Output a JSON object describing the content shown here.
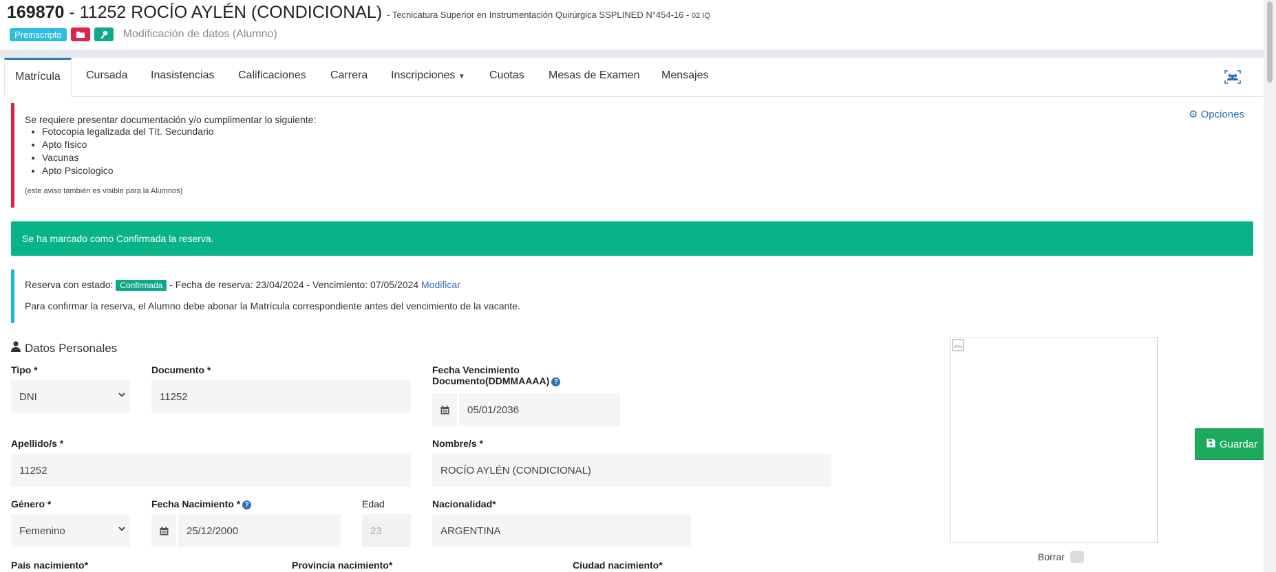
{
  "header": {
    "id": "169870",
    "separator": "-",
    "name": "11252 ROCÍO AYLÉN (CONDICIONAL)",
    "career": "- Tecnicatura Superior en Instrumentación Quirúrgica SSPLINED N°454-16 -",
    "group": "02 IQ",
    "status_badge": "Preinscripto",
    "modification_text": "Modificación de datos (Alumno)"
  },
  "tabs": [
    {
      "label": "Matrícula"
    },
    {
      "label": "Cursada"
    },
    {
      "label": "Inasistencias"
    },
    {
      "label": "Calificaciones"
    },
    {
      "label": "Carrera"
    },
    {
      "label": "Inscripciones"
    },
    {
      "label": "Cuotas"
    },
    {
      "label": "Mesas de Examen"
    },
    {
      "label": "Mensajes"
    }
  ],
  "options_link": "Opciones",
  "requirements": {
    "intro": "Se requiere presentar documentación y/o cumplimentar lo siguiente:",
    "items": [
      "Fotocopia legalizada del Tít. Secundario",
      "Apto físico",
      "Vacunas",
      "Apto Psicologico"
    ],
    "note": "(este aviso también es visible para la Alumnos)"
  },
  "success_message": "Se ha marcado como Confirmada la reserva.",
  "reservation": {
    "prefix": "Reserva con estado:",
    "status": "Confirmada",
    "details": "- Fecha de reserva: 23/04/2024 - Vencimiento: 07/05/2024",
    "modify_link": "Modificar",
    "info": "Para confirmar la reserva, el Alumno debe abonar la Matrícula correspondiente antes del vencimiento de la vacante."
  },
  "personal": {
    "section_title": "Datos Personales",
    "tipo_label": "Tipo *",
    "tipo_value": "DNI",
    "documento_label": "Documento *",
    "documento_value": "11252",
    "vto_label_1": "Fecha Vencimiento",
    "vto_label_2": "Documento(DDMMAAAA)",
    "vto_value": "05/01/2036",
    "apellido_label": "Apellido/s *",
    "apellido_value": "11252",
    "nombre_label": "Nombre/s *",
    "nombre_value": "ROCÍO AYLÉN (CONDICIONAL)",
    "genero_label": "Género *",
    "genero_value": "Femenino",
    "nacimiento_label": "Fecha Nacimiento *",
    "nacimiento_value": "25/12/2000",
    "edad_label": "Edad",
    "edad_value": "23",
    "nacionalidad_label": "Nacionalidad*",
    "nacionalidad_value": "ARGENTINA",
    "pais_label": "País nacimiento*",
    "provincia_label": "Provincia nacimiento*",
    "ciudad_label": "Ciudad nacimiento*"
  },
  "photo": {
    "delete_label": "Borrar"
  },
  "save_button": "Guardar"
}
